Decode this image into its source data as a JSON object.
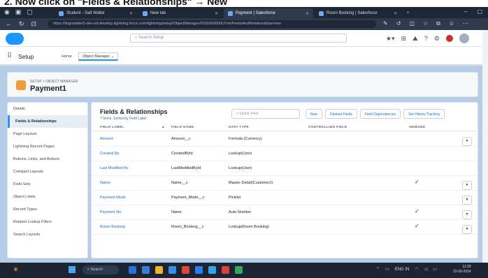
{
  "caption": "2. Now click on \"Fields & Relationships\" → New",
  "browser": {
    "tabs": [
      {
        "label": "Student - Salt Wallet",
        "active": false
      },
      {
        "label": "New tab",
        "active": false
      },
      {
        "label": "Payment | Salesforce",
        "active": true
      },
      {
        "label": "Room Booking | Salesforce",
        "active": false
      }
    ],
    "url": "https://lingowalter5-dev-ed.develop.lightning.force.com/lightning/setup/ObjectManager/01I5i000000UVxh/FieldsAndRelationships/view"
  },
  "salesforce": {
    "search_placeholder": "Search Setup",
    "app_name": "Setup",
    "home_tab": "Home",
    "object_manager_tab": "Object Manager"
  },
  "object": {
    "breadcrumb": "SETUP > OBJECT MANAGER",
    "title": "Payment1"
  },
  "sidebar": {
    "items": [
      {
        "label": "Details",
        "active": false
      },
      {
        "label": "Fields & Relationships",
        "active": true
      },
      {
        "label": "Page Layouts",
        "active": false
      },
      {
        "label": "Lightning Record Pages",
        "active": false
      },
      {
        "label": "Buttons, Links, and Actions",
        "active": false
      },
      {
        "label": "Compact Layouts",
        "active": false
      },
      {
        "label": "Field Sets",
        "active": false
      },
      {
        "label": "Object Limits",
        "active": false
      },
      {
        "label": "Record Types",
        "active": false
      },
      {
        "label": "Related Lookup Filters",
        "active": false
      },
      {
        "label": "Search Layouts",
        "active": false
      }
    ]
  },
  "fields_section": {
    "title": "Fields & Relationships",
    "subtitle": "7 Items, Sorted by Field Label",
    "quick_find_placeholder": "Quick Find",
    "buttons": [
      "New",
      "Deleted Fields",
      "Field Dependencies",
      "Set History Tracking"
    ],
    "columns": [
      "FIELD LABEL",
      "FIELD NAME",
      "DATA TYPE",
      "CONTROLLING FIELD",
      "INDEXED"
    ],
    "rows": [
      {
        "label": "Amount",
        "name": "Amount__c",
        "type": "Formula (Currency)",
        "indexed": false
      },
      {
        "label": "Created By",
        "name": "CreatedById",
        "type": "Lookup(User)",
        "indexed": false
      },
      {
        "label": "Last Modified By",
        "name": "LastModifiedById",
        "type": "Lookup(User)",
        "indexed": false
      },
      {
        "label": "Name",
        "name": "Name__c",
        "type": "Master-Detail(Customer1)",
        "indexed": true
      },
      {
        "label": "Payment Mode",
        "name": "Payment_Mode__c",
        "type": "Picklist",
        "indexed": false
      },
      {
        "label": "Payment No",
        "name": "Name",
        "type": "Auto Number",
        "indexed": true
      },
      {
        "label": "Room Booking",
        "name": "Room_Booking__c",
        "type": "Lookup(Room Booking)",
        "indexed": true
      }
    ]
  },
  "taskbar": {
    "search": "Search",
    "time": "11:39",
    "date": "22-09-2024",
    "lang": "ENG IN"
  }
}
